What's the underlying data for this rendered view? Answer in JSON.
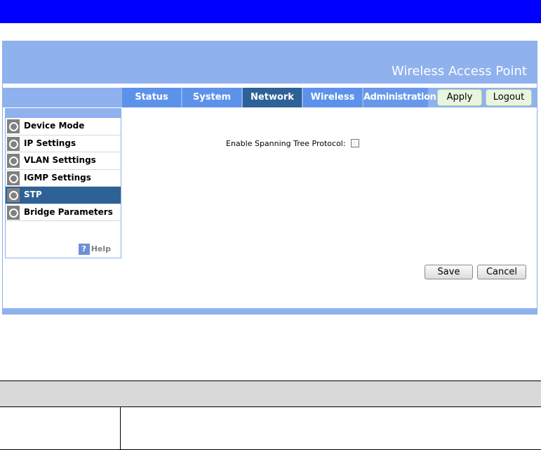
{
  "header": {
    "title": "Wireless Access Point"
  },
  "tabs": [
    {
      "label": "Status"
    },
    {
      "label": "System"
    },
    {
      "label": "Network"
    },
    {
      "label": "Wireless"
    },
    {
      "label": "Administration"
    }
  ],
  "active_tab": "Network",
  "toolbar": {
    "apply_label": "Apply",
    "logout_label": "Logout"
  },
  "sidebar": {
    "items": [
      {
        "label": "Device Mode"
      },
      {
        "label": "IP Settings"
      },
      {
        "label": "VLAN Setttings"
      },
      {
        "label": "IGMP Settings"
      },
      {
        "label": "STP"
      },
      {
        "label": "Bridge Parameters"
      }
    ],
    "active_item": "STP",
    "help_label": "Help",
    "help_icon_glyph": "?"
  },
  "form": {
    "stp_label": "Enable Spanning Tree Protocol:",
    "stp_enabled": false,
    "save_label": "Save",
    "cancel_label": "Cancel"
  },
  "colors": {
    "top_bar": "#0000ff",
    "banner": "#8fb1ee",
    "tab": "#5d92ea",
    "tab_active": "#2e6196",
    "sidebar_active": "#2e6196",
    "ghost_button": "#e8f6df"
  },
  "icons": {
    "sidebar_bullet": "radio-circle-icon",
    "help": "question-icon"
  }
}
